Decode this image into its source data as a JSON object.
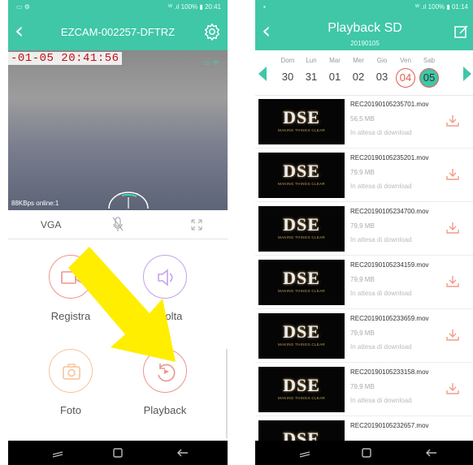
{
  "left": {
    "status": {
      "left": "▭ ⚙",
      "right": "ᵂ .ıl 100% ▮ 20:41"
    },
    "title": "EZCAM-002257-DFTRZ",
    "osd_time": "-01-05 20:41:56",
    "bitrate": "88KBps online:1",
    "resolution": "VGA",
    "actions": [
      {
        "label": "Registra",
        "color": "#f0938e"
      },
      {
        "label": "Ascolta",
        "color": "#c3a3e8"
      },
      {
        "label": "Foto",
        "color": "#f5c49a"
      },
      {
        "label": "Playback",
        "color": "#f0938e"
      }
    ],
    "arrow_color": "#ffee00"
  },
  "right": {
    "status": {
      "left": "▪",
      "right": "ᵂ .ıl 100% ▮ 01:14"
    },
    "title": "Playback SD",
    "subtitle": "20190105",
    "days": [
      {
        "name": "Dom",
        "num": "30",
        "state": ""
      },
      {
        "name": "Lun",
        "num": "31",
        "state": ""
      },
      {
        "name": "Mar",
        "num": "01",
        "state": ""
      },
      {
        "name": "Mer",
        "num": "02",
        "state": ""
      },
      {
        "name": "Gio",
        "num": "03",
        "state": ""
      },
      {
        "name": "Ven",
        "num": "04",
        "state": "ring"
      },
      {
        "name": "Sab",
        "num": "05",
        "state": "sel"
      }
    ],
    "thumb_logo": "DSE",
    "thumb_tag": "MAKING THINGS CLEAR",
    "files": [
      {
        "name": "REC20190105235701.mov",
        "size": "56,5 MB",
        "status": "In attesa di download"
      },
      {
        "name": "REC20190105235201.mov",
        "size": "79,9 MB",
        "status": "In attesa di download"
      },
      {
        "name": "REC20190105234700.mov",
        "size": "79,9 MB",
        "status": "In attesa di download"
      },
      {
        "name": "REC20190105234159.mov",
        "size": "79,9 MB",
        "status": "In attesa di download"
      },
      {
        "name": "REC20190105233659.mov",
        "size": "79,9 MB",
        "status": "In attesa di download"
      },
      {
        "name": "REC20190105233158.mov",
        "size": "79,9 MB",
        "status": "In attesa di download"
      },
      {
        "name": "REC20190105232657.mov",
        "size": "",
        "status": ""
      }
    ]
  },
  "colors": {
    "accent": "#3fc7a7",
    "download": "#f39a86"
  }
}
